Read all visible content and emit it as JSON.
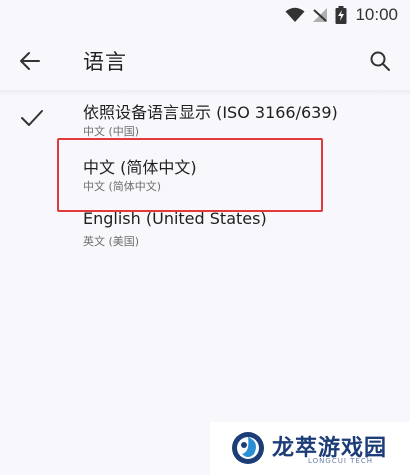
{
  "status_bar": {
    "time": "10:00",
    "icons": [
      "wifi-icon",
      "signal-off-icon",
      "battery-charging-icon"
    ]
  },
  "app_bar": {
    "title": "语言",
    "back_icon": "arrow-left-icon",
    "search_icon": "search-icon"
  },
  "languages": [
    {
      "label": "依照设备语言显示 (ISO 3166/639)",
      "sublabel": "中文 (中国)",
      "selected": true
    },
    {
      "label": "中文 (简体中文)",
      "sublabel": "中文 (简体中文)",
      "selected": false
    },
    {
      "label": "English (United States)",
      "sublabel": "英文 (美国)",
      "selected": false
    }
  ],
  "annotation": {
    "highlight_color": "#e03a3a"
  },
  "watermark": {
    "name": "龙萃游戏园",
    "sub": "LONGCUI TECH"
  }
}
